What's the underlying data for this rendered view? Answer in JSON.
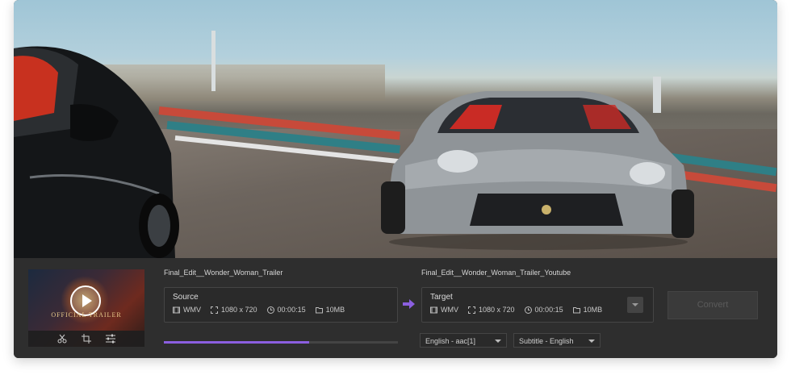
{
  "thumbnail": {
    "caption": "OFFICIAL TRAILER"
  },
  "source": {
    "filename": "Final_Edit__Wonder_Woman_Trailer",
    "label": "Source",
    "format": "WMV",
    "resolution": "1080 x 720",
    "duration": "00:00:15",
    "size": "10MB",
    "progress": 0.62
  },
  "target": {
    "filename": "Final_Edit__Wonder_Woman_Trailer_Youtube",
    "label": "Target",
    "format": "WMV",
    "resolution": "1080 x 720",
    "duration": "00:00:15",
    "size": "10MB"
  },
  "audio_select": {
    "value": "English - aac[1]"
  },
  "subtitle_select": {
    "value": "Subtitle - English"
  },
  "convert_button": {
    "label": "Convert"
  },
  "colors": {
    "accent": "#8b5fe0",
    "panel": "#2e2e2e"
  }
}
